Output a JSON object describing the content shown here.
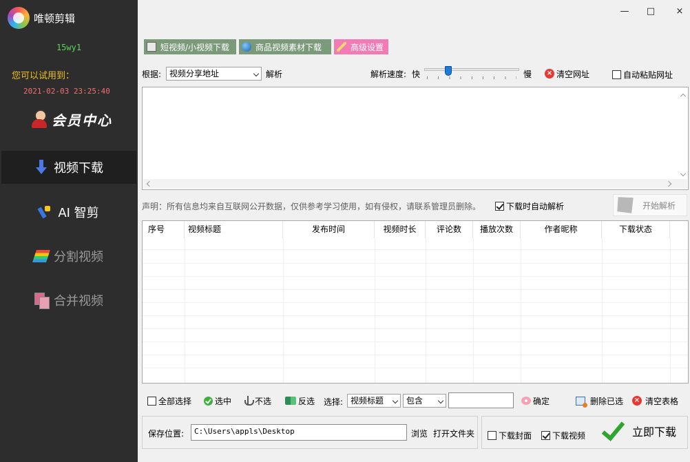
{
  "app": {
    "title": "唯顿剪辑",
    "username": "15wy1",
    "trial_label": "您可以试用到：",
    "trial_date": "2021-02-03 23:25:40",
    "member_center": "会员中心"
  },
  "window_controls": {
    "minimize": "×",
    "maximize": "□",
    "close": "×"
  },
  "sidebar": {
    "items": [
      {
        "label": "视频下载",
        "icon": "download-arrow-icon",
        "state": "active"
      },
      {
        "label": "AI 智剪",
        "icon": "ai-wand-icon",
        "state": "normal"
      },
      {
        "label": "分割视频",
        "icon": "split-stripes-icon",
        "state": "disabled"
      },
      {
        "label": "合并视频",
        "icon": "merge-pages-icon",
        "state": "disabled"
      }
    ]
  },
  "tabs": [
    {
      "label": "短视频/小视频下载",
      "color": "#7a9a7a"
    },
    {
      "label": "商品视频素材下载",
      "color": "#7a9a7a"
    },
    {
      "label": "高级设置",
      "color": "#f27bb5"
    }
  ],
  "parse_bar": {
    "source_label": "根据:",
    "source_value": "视频分享地址",
    "parse_label": "解析",
    "speed_label": "解析速度:",
    "speed_fast": "快",
    "speed_slow": "慢",
    "speed_level": 0.22,
    "clear_url": "清空网址",
    "auto_paste": "自动粘贴网址",
    "auto_paste_checked": false
  },
  "url_input": {
    "value": ""
  },
  "notice": {
    "disclaimer": "声明：所有信息均来自互联网公开数据，仅供参考学习使用，如有侵权，请联系管理员删除。",
    "auto_parse": "下载时自动解析",
    "auto_parse_checked": true,
    "start_parse": "开始解析"
  },
  "table": {
    "headers": [
      "序号",
      "视频标题",
      "发布时间",
      "视频时长",
      "评论数",
      "播放次数",
      "作者昵称",
      "下载状态"
    ],
    "rows": []
  },
  "actions": {
    "select_all": "全部选择",
    "select_all_checked": false,
    "select": "选中",
    "unselect": "不选",
    "invert": "反选",
    "filter_label": "选择:",
    "filter_field": "视频标题",
    "filter_mode": "包含",
    "filter_text": "",
    "confirm": "确定",
    "delete_selected": "删除已选",
    "clear_table": "清空表格"
  },
  "save": {
    "label": "保存位置:",
    "path": "C:\\Users\\appls\\Desktop",
    "browse": "浏览",
    "open_folder": "打开文件夹"
  },
  "download": {
    "cover": "下载封面",
    "cover_checked": false,
    "video": "下载视频",
    "video_checked": true,
    "now": "立即下载"
  }
}
